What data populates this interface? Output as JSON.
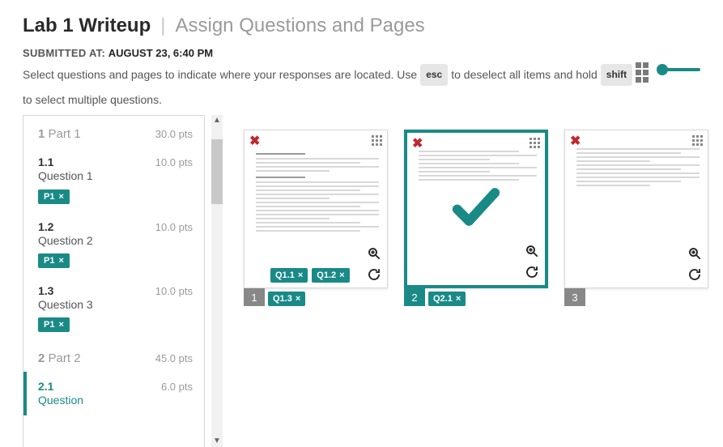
{
  "header": {
    "title_main": "Lab 1 Writeup",
    "title_sub": "Assign Questions and Pages",
    "submitted_label": "SUBMITTED AT:",
    "submitted_time": "AUGUST 23, 6:40 PM",
    "instr_pre": "Select questions and pages to indicate where your responses are located. Use",
    "key_esc": "esc",
    "instr_mid": "to deselect all items and hold",
    "key_shift": "shift",
    "instr_post": "to select multiple questions."
  },
  "outline": {
    "sections": [
      {
        "num": "1",
        "name": "Part 1",
        "pts": "30.0 pts",
        "questions": [
          {
            "num": "1.1",
            "title": "Question 1",
            "pts": "10.0 pts",
            "tags": [
              "P1"
            ]
          },
          {
            "num": "1.2",
            "title": "Question 2",
            "pts": "10.0 pts",
            "tags": [
              "P1"
            ]
          },
          {
            "num": "1.3",
            "title": "Question 3",
            "pts": "10.0 pts",
            "tags": [
              "P1"
            ]
          }
        ]
      },
      {
        "num": "2",
        "name": "Part 2",
        "pts": "45.0 pts",
        "questions": [
          {
            "num": "2.1",
            "title": "Question",
            "pts": "6.0 pts",
            "tags": [],
            "active": true
          }
        ]
      }
    ]
  },
  "pages": [
    {
      "num": "1",
      "selected": false,
      "chips": [
        "Q1.1",
        "Q1.2"
      ],
      "footer_chips": [
        "Q1.3"
      ]
    },
    {
      "num": "2",
      "selected": true,
      "chips": [],
      "footer_chips": [
        "Q2.1"
      ],
      "checkmark": true
    },
    {
      "num": "3",
      "selected": false,
      "chips": [],
      "footer_chips": []
    }
  ],
  "icons": {
    "close_x": "×"
  }
}
